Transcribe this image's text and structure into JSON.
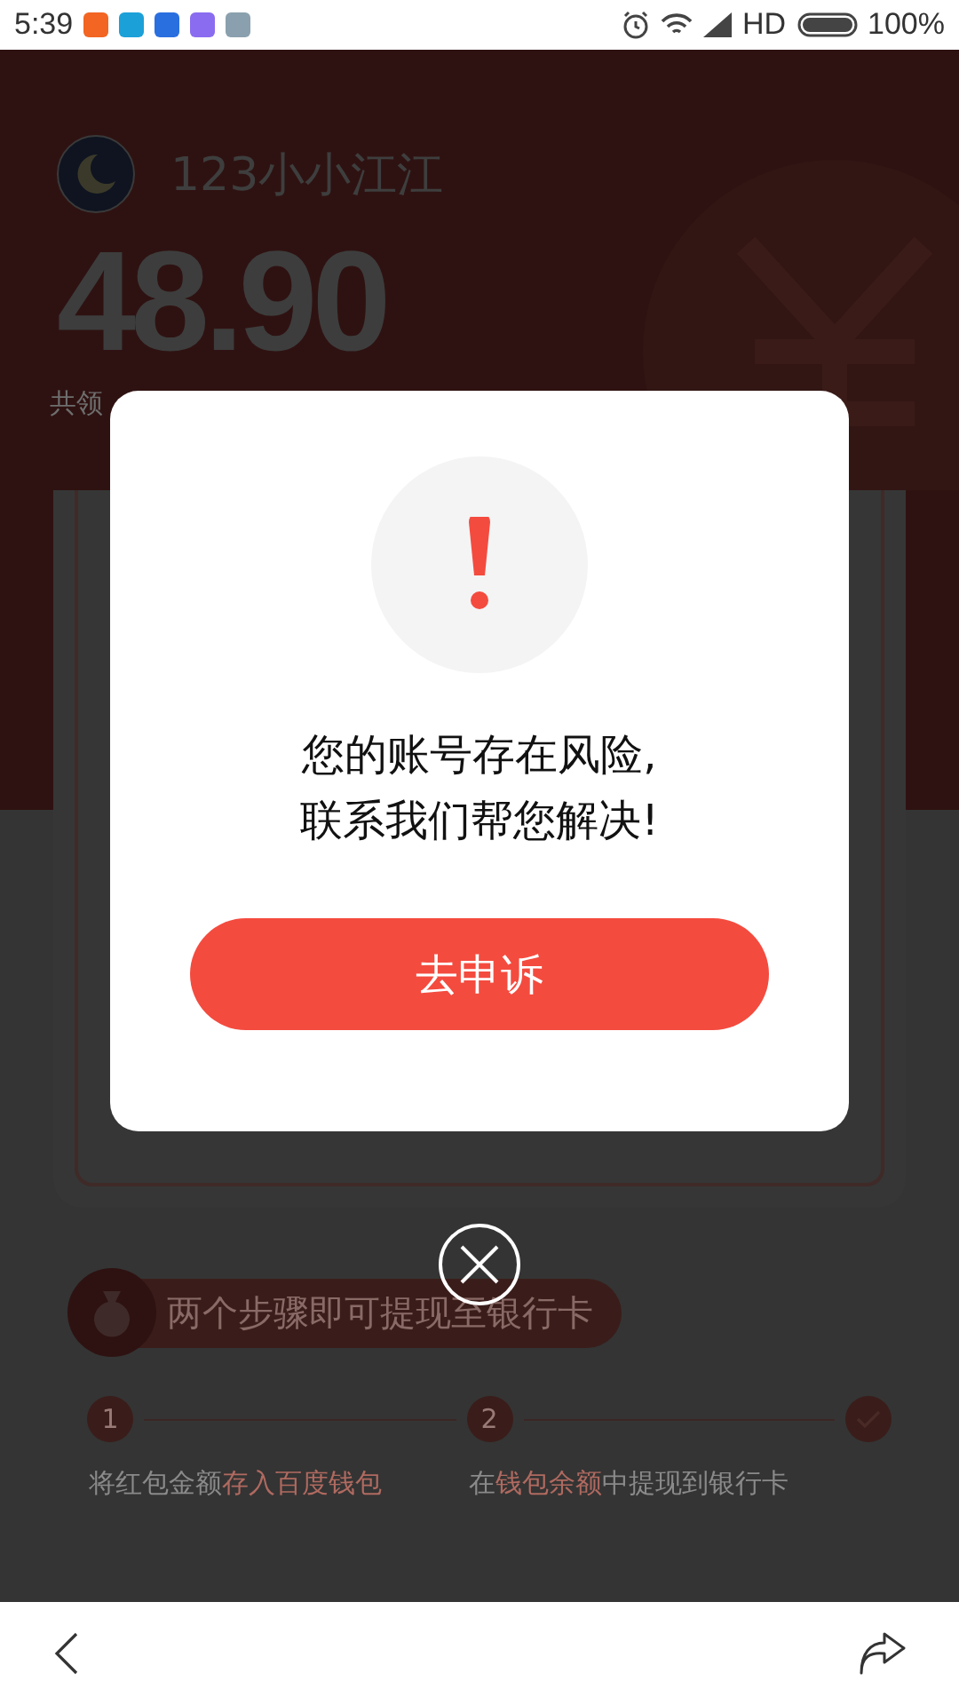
{
  "status_bar": {
    "time": "5:39",
    "network": "HD",
    "battery": "100%"
  },
  "header": {
    "name": "123小小江江",
    "amount": "48.90",
    "caption": "共领"
  },
  "dialog": {
    "message": [
      "您的账号存在风险,",
      "联系我们帮您解决!"
    ],
    "button": "去申诉"
  },
  "steps_banner": {
    "title": "两个步骤即可提现至银行卡"
  },
  "steps": [
    {
      "kind": "number",
      "marker": "1",
      "parts": [
        {
          "text": "将红包金额",
          "highlight": false
        },
        {
          "text": "存入百度钱包",
          "highlight": true
        }
      ]
    },
    {
      "kind": "number",
      "marker": "2",
      "parts": [
        {
          "text": "在",
          "highlight": false
        },
        {
          "text": "钱包余额",
          "highlight": true
        },
        {
          "text": "中提现到银行卡",
          "highlight": false
        }
      ]
    },
    {
      "kind": "done"
    }
  ]
}
